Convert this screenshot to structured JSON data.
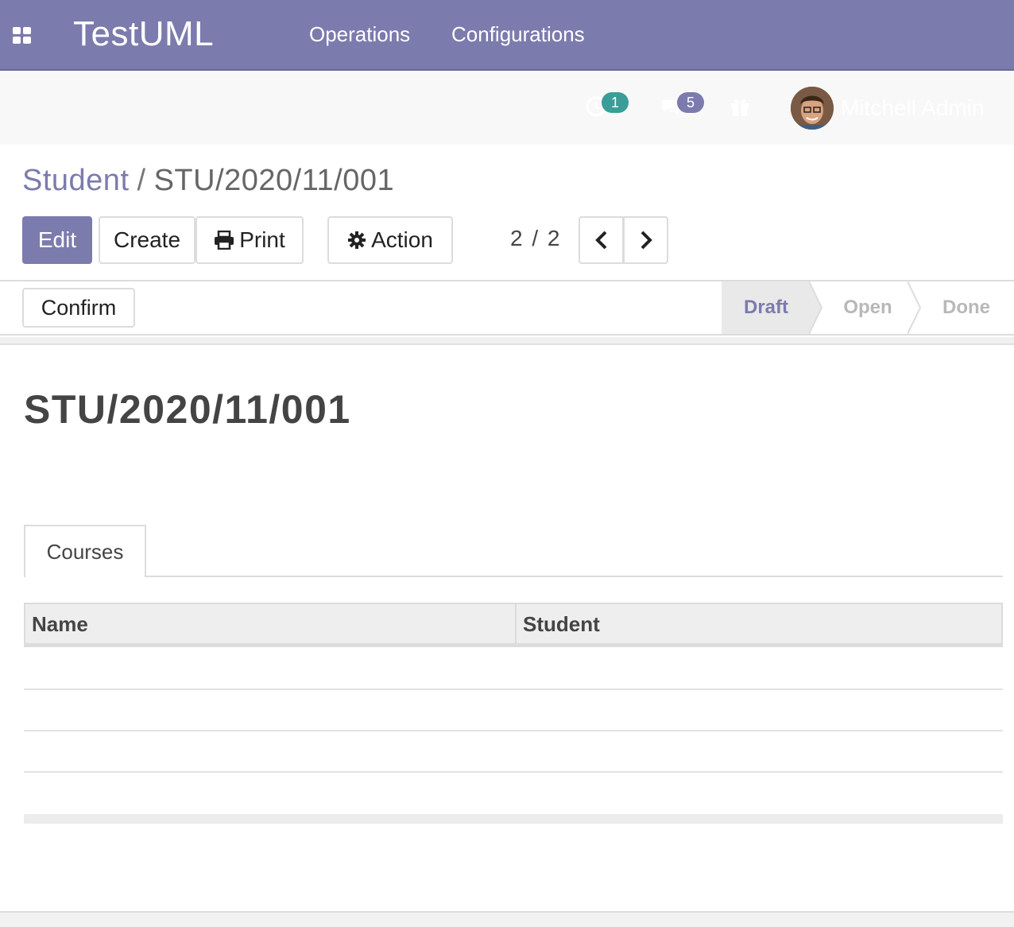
{
  "topbar": {
    "brand": "TestUML",
    "menu": [
      "Operations",
      "Configurations"
    ],
    "color": "#7c7bad"
  },
  "systray": {
    "activity_count": "1",
    "message_count": "5",
    "user_name": "Mitchell Admin",
    "activity_badge_color": "#3a9d98",
    "message_badge_color": "#7c7bad"
  },
  "breadcrumb": {
    "parent": "Student",
    "separator": "/",
    "current": "STU/2020/11/001"
  },
  "control_panel": {
    "edit_label": "Edit",
    "create_label": "Create",
    "print_label": "Print",
    "action_label": "Action",
    "pager_value": "2 / 2"
  },
  "statusbar": {
    "confirm_label": "Confirm",
    "stages": [
      "Draft",
      "Open",
      "Done"
    ],
    "active_stage": "Draft"
  },
  "form": {
    "title": "STU/2020/11/001",
    "tab_label": "Courses",
    "columns": [
      "Name",
      "Student"
    ],
    "rows": []
  }
}
